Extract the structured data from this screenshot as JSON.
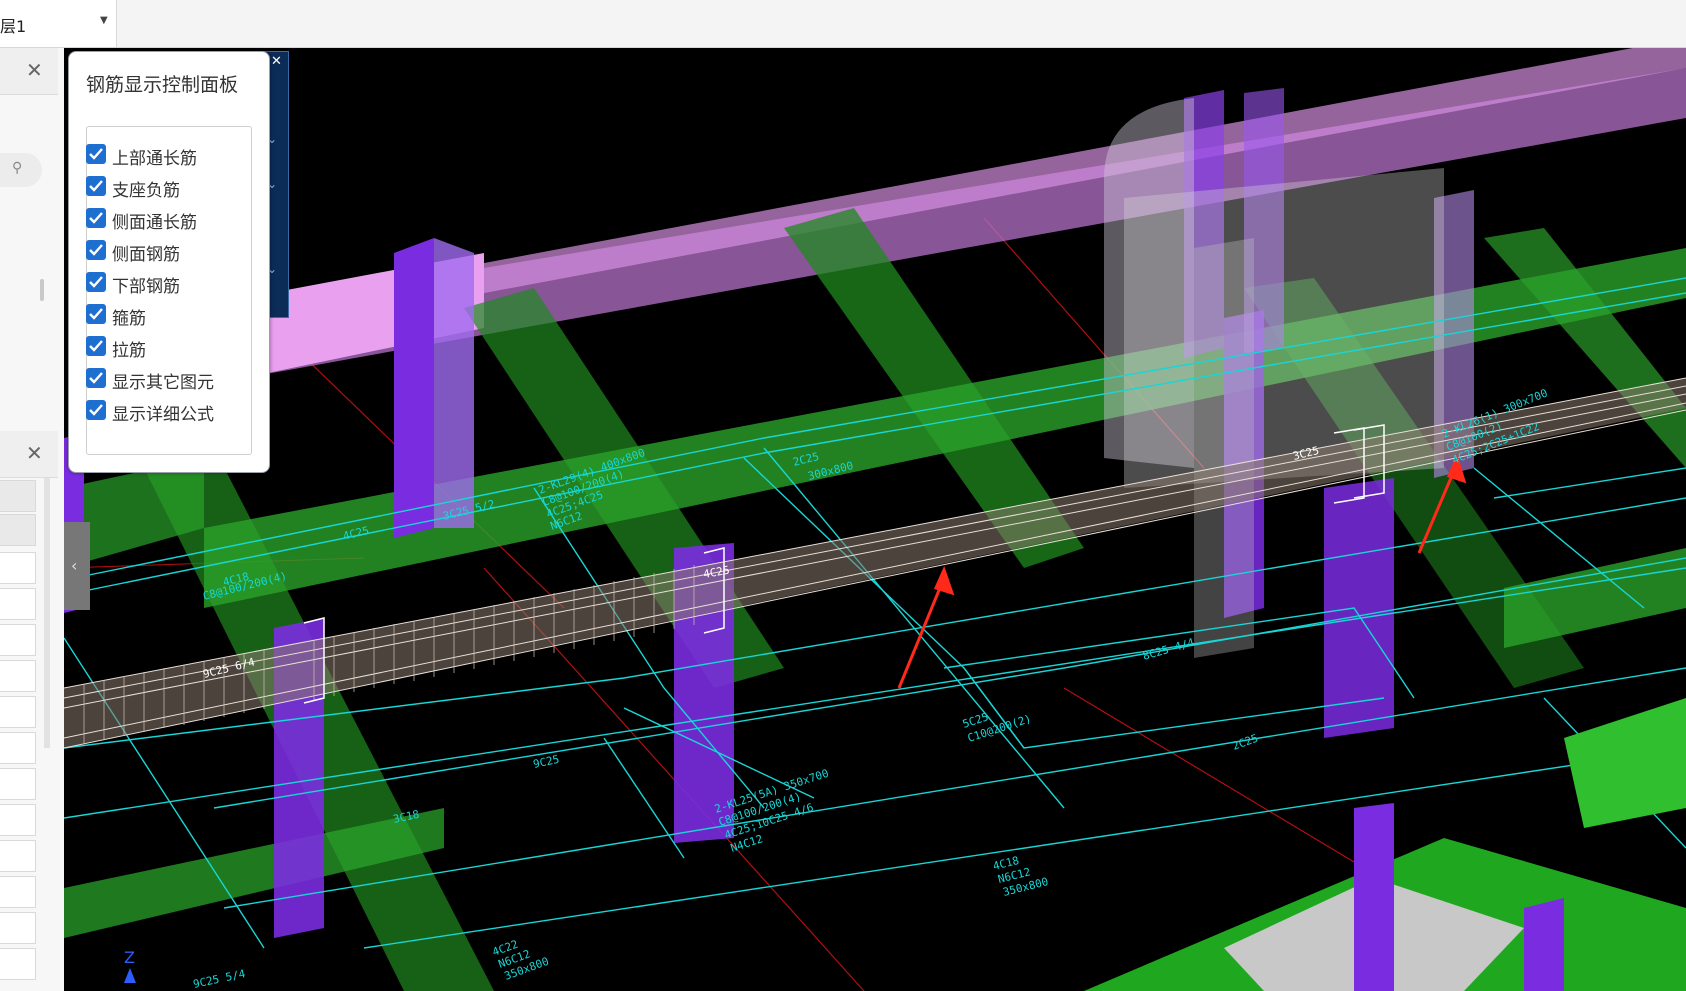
{
  "toolbar": {
    "floor_label": "层1"
  },
  "control_panel": {
    "title": "钢筋显示控制面板",
    "options": [
      {
        "label": "上部通长筋",
        "checked": true
      },
      {
        "label": "支座负筋",
        "checked": true
      },
      {
        "label": "侧面通长筋",
        "checked": true
      },
      {
        "label": "侧面钢筋",
        "checked": true
      },
      {
        "label": "下部钢筋",
        "checked": true
      },
      {
        "label": "箍筋",
        "checked": true
      },
      {
        "label": "拉筋",
        "checked": true
      },
      {
        "label": "显示其它图元",
        "checked": true
      },
      {
        "label": "显示详细公式",
        "checked": true
      }
    ]
  },
  "annotations": {
    "a1": "2-KL29(4) 400x800",
    "a2": "C8@100/200(4)",
    "a3": "4C25;4C25",
    "a4": "N6C12",
    "a5": "2C25",
    "a6": "300x800",
    "a7": "4C25",
    "a8": "3C25 5/2",
    "a9": "4C18",
    "a10": "C8@100/200(4)",
    "a11": "9C25 6/4",
    "a12": "2-KL25(5A) 350x700",
    "a13": "C8@100/200(4)",
    "a14": "4C25;10C25 4/6",
    "a15": "N4C12",
    "a16": "5C25",
    "a17": "C10@200(2)",
    "a18": "8C25 4/4",
    "a19": "4C18",
    "a20": "N6C12",
    "a21": "350x800",
    "a22": "4C22",
    "a23": "N6C12",
    "a24": "350x800",
    "a25": "9C25 5/4",
    "a26": "2-KL26(1) 300x700",
    "a27": "C8@100(2)",
    "a28": "4C25;2C25+1C22",
    "a29": "3C25",
    "a30": "2C25",
    "a31": "4C25",
    "a32": "9C25",
    "a33": "3C18"
  }
}
